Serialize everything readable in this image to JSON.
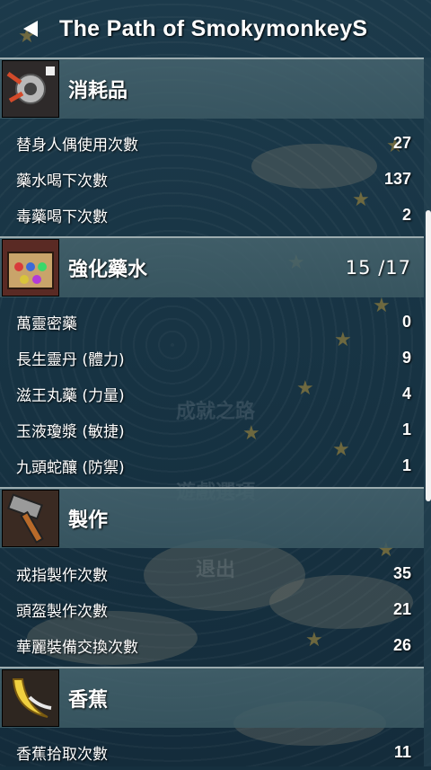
{
  "header": {
    "title": "The Path of SmokymonkeyS"
  },
  "background_menu": {
    "item1": "成就之路",
    "item2": "遊戲選項",
    "item3": "退出"
  },
  "sections": [
    {
      "title": "消耗品",
      "icon": "doll-icon",
      "count": "",
      "rows": [
        {
          "label": "替身人偶使用次數",
          "value": "27"
        },
        {
          "label": "藥水喝下次數",
          "value": "137"
        },
        {
          "label": "毒藥喝下次數",
          "value": "2"
        }
      ]
    },
    {
      "title": "強化藥水",
      "icon": "potion-box-icon",
      "count": "15 /17",
      "rows": [
        {
          "label": "萬靈密藥",
          "value": "0"
        },
        {
          "label": "長生靈丹 (體力)",
          "value": "9"
        },
        {
          "label": "滋王丸藥 (力量)",
          "value": "4"
        },
        {
          "label": "玉液瓊漿 (敏捷)",
          "value": "1"
        },
        {
          "label": "九頭蛇釀 (防禦)",
          "value": "1"
        }
      ]
    },
    {
      "title": "製作",
      "icon": "hammer-icon",
      "count": "",
      "rows": [
        {
          "label": "戒指製作次數",
          "value": "35"
        },
        {
          "label": "頭盔製作次數",
          "value": "21"
        },
        {
          "label": "華麗裝備交換次數",
          "value": "26"
        }
      ]
    },
    {
      "title": "香蕉",
      "icon": "banana-icon",
      "count": "",
      "rows": [
        {
          "label": "香蕉拾取次數",
          "value": "11"
        }
      ]
    }
  ]
}
